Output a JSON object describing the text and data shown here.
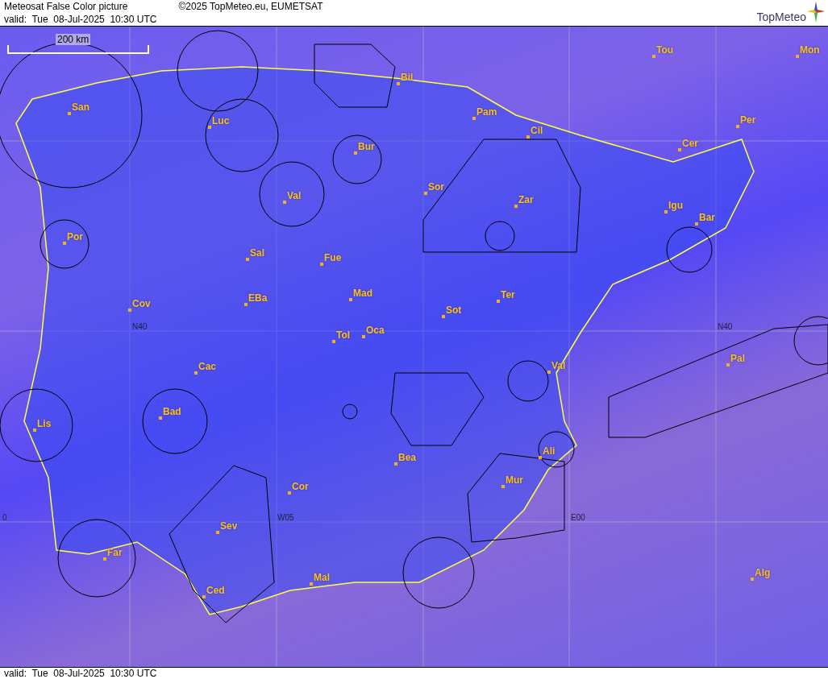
{
  "header": {
    "title": "Meteosat False Color picture",
    "copyright": "©2025 TopMeteo.eu, EUMETSAT",
    "valid": "valid:  Tue  08-Jul-2025  10:30 UTC",
    "logo": "TopMeteo"
  },
  "map": {
    "scale": "200 km",
    "cities": [
      {
        "label": "San"
      },
      {
        "label": "Luc"
      },
      {
        "label": "Bil"
      },
      {
        "label": "Pam"
      },
      {
        "label": "Cil"
      },
      {
        "label": "Tou"
      },
      {
        "label": "Mon"
      },
      {
        "label": "Per"
      },
      {
        "label": "Cer"
      },
      {
        "label": "Bur"
      },
      {
        "label": "Sor"
      },
      {
        "label": "Val"
      },
      {
        "label": "Zar"
      },
      {
        "label": "Igu"
      },
      {
        "label": "Bar"
      },
      {
        "label": "Por"
      },
      {
        "label": "Sal"
      },
      {
        "label": "Fue"
      },
      {
        "label": "Mad"
      },
      {
        "label": "EBa"
      },
      {
        "label": "Cov"
      },
      {
        "label": "Sot"
      },
      {
        "label": "Ter"
      },
      {
        "label": "Tol"
      },
      {
        "label": "Oca"
      },
      {
        "label": "Cac"
      },
      {
        "label": "Pal"
      },
      {
        "label": "Val"
      },
      {
        "label": "Bad"
      },
      {
        "label": "Lis"
      },
      {
        "label": "Bea"
      },
      {
        "label": "Ali"
      },
      {
        "label": "Mur"
      },
      {
        "label": "Cor"
      },
      {
        "label": "Sev"
      },
      {
        "label": "Far"
      },
      {
        "label": "Mal"
      },
      {
        "label": "Ced"
      },
      {
        "label": "Alg"
      }
    ],
    "grid_labels": [
      {
        "label": "N40"
      },
      {
        "label": "N40"
      },
      {
        "label": "0"
      },
      {
        "label": "W05"
      },
      {
        "label": "E00"
      }
    ]
  },
  "footer": {
    "valid": "valid:  Tue  08-Jul-2025  10:30 UTC"
  }
}
